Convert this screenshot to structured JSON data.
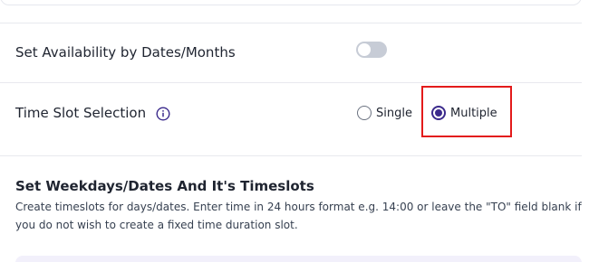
{
  "availability": {
    "label": "Set Availability by Dates/Months",
    "toggle_on": false
  },
  "time_slot": {
    "label": "Time Slot Selection",
    "info_icon": "info-circle-icon",
    "options": [
      {
        "label": "Single",
        "selected": false
      },
      {
        "label": "Multiple",
        "selected": true
      }
    ],
    "highlight_color": "#e31b1b"
  },
  "timeslots_section": {
    "title": "Set Weekdays/Dates And It's Timeslots",
    "description": "Create timeslots for days/dates. Enter time in 24 hours format e.g. 14:00 or leave the \"TO\" field blank if you do not wish to create a fixed time duration slot."
  },
  "colors": {
    "accent": "#3b2a8c",
    "toggle_off": "#c7ccd6",
    "divider": "#e8e9ee"
  }
}
